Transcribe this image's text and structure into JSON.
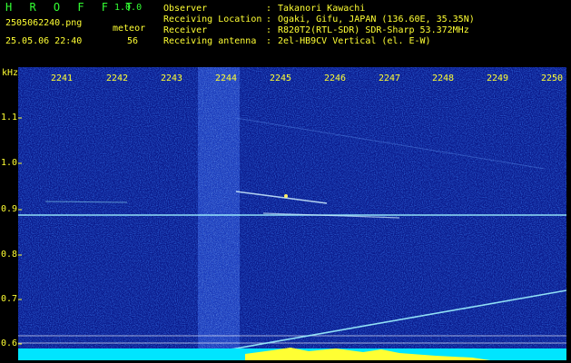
{
  "header": {
    "app_name": "H R O F F T",
    "version": "1.0.0",
    "filename": "2505062240.png",
    "datetime": "25.05.06 22:40",
    "meteor_label": "meteor",
    "meteor_count": "56",
    "rows": [
      {
        "label": "Observer",
        "sep": ":",
        "value": "Takanori Kawachi"
      },
      {
        "label": "Receiving Location",
        "sep": ":",
        "value": "Ogaki, Gifu, JAPAN (136.60E, 35.35N)"
      },
      {
        "label": "Receiver",
        "sep": ":",
        "value": "R820T2(RTL-SDR) SDR-Sharp 53.372MHz"
      },
      {
        "label": "Receiving antenna",
        "sep": ":",
        "value": "2el-HB9CV Vertical (el. E-W)"
      }
    ]
  },
  "axes": {
    "y_unit": "kHz",
    "y_ticks": [
      "1.1",
      "1.0",
      "0.9",
      "0.8",
      "0.7",
      "0.6"
    ],
    "x_ticks": [
      "2241",
      "2242",
      "2243",
      "2244",
      "2245",
      "2246",
      "2247",
      "2248",
      "2249",
      "2250"
    ]
  },
  "colors": {
    "background": "#000000",
    "waterfall_base": "#0a1a8c",
    "label": "#ffff33",
    "title": "#33ff33",
    "signal": "#9ff4ff",
    "intensity_bar": "#00e5ff"
  }
}
